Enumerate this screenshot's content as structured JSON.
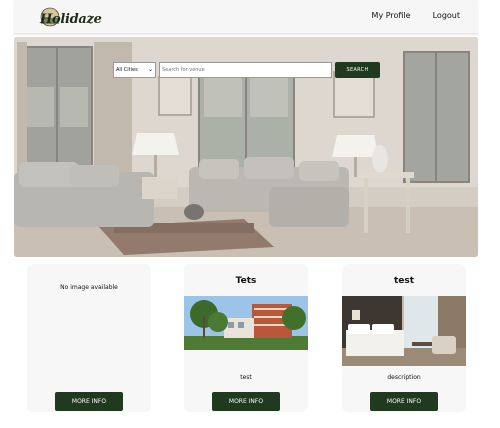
{
  "header": {
    "logo_text": "Holidaze",
    "nav": {
      "profile": "My Profile",
      "logout": "Logout"
    }
  },
  "search": {
    "city_selected": "All Cities",
    "placeholder": "Search for venue",
    "button_label": "SEARCH"
  },
  "cards": [
    {
      "title": "",
      "no_image_text": "No image available",
      "description": "",
      "button_label": "MORE INFO"
    },
    {
      "title": "Tets",
      "description": "test",
      "button_label": "MORE INFO"
    },
    {
      "title": "test",
      "description": "description",
      "button_label": "MORE INFO"
    }
  ],
  "colors": {
    "accent": "#1f3a1f",
    "header_bg": "#f6f6f6",
    "card_bg": "#f7f7f7"
  }
}
